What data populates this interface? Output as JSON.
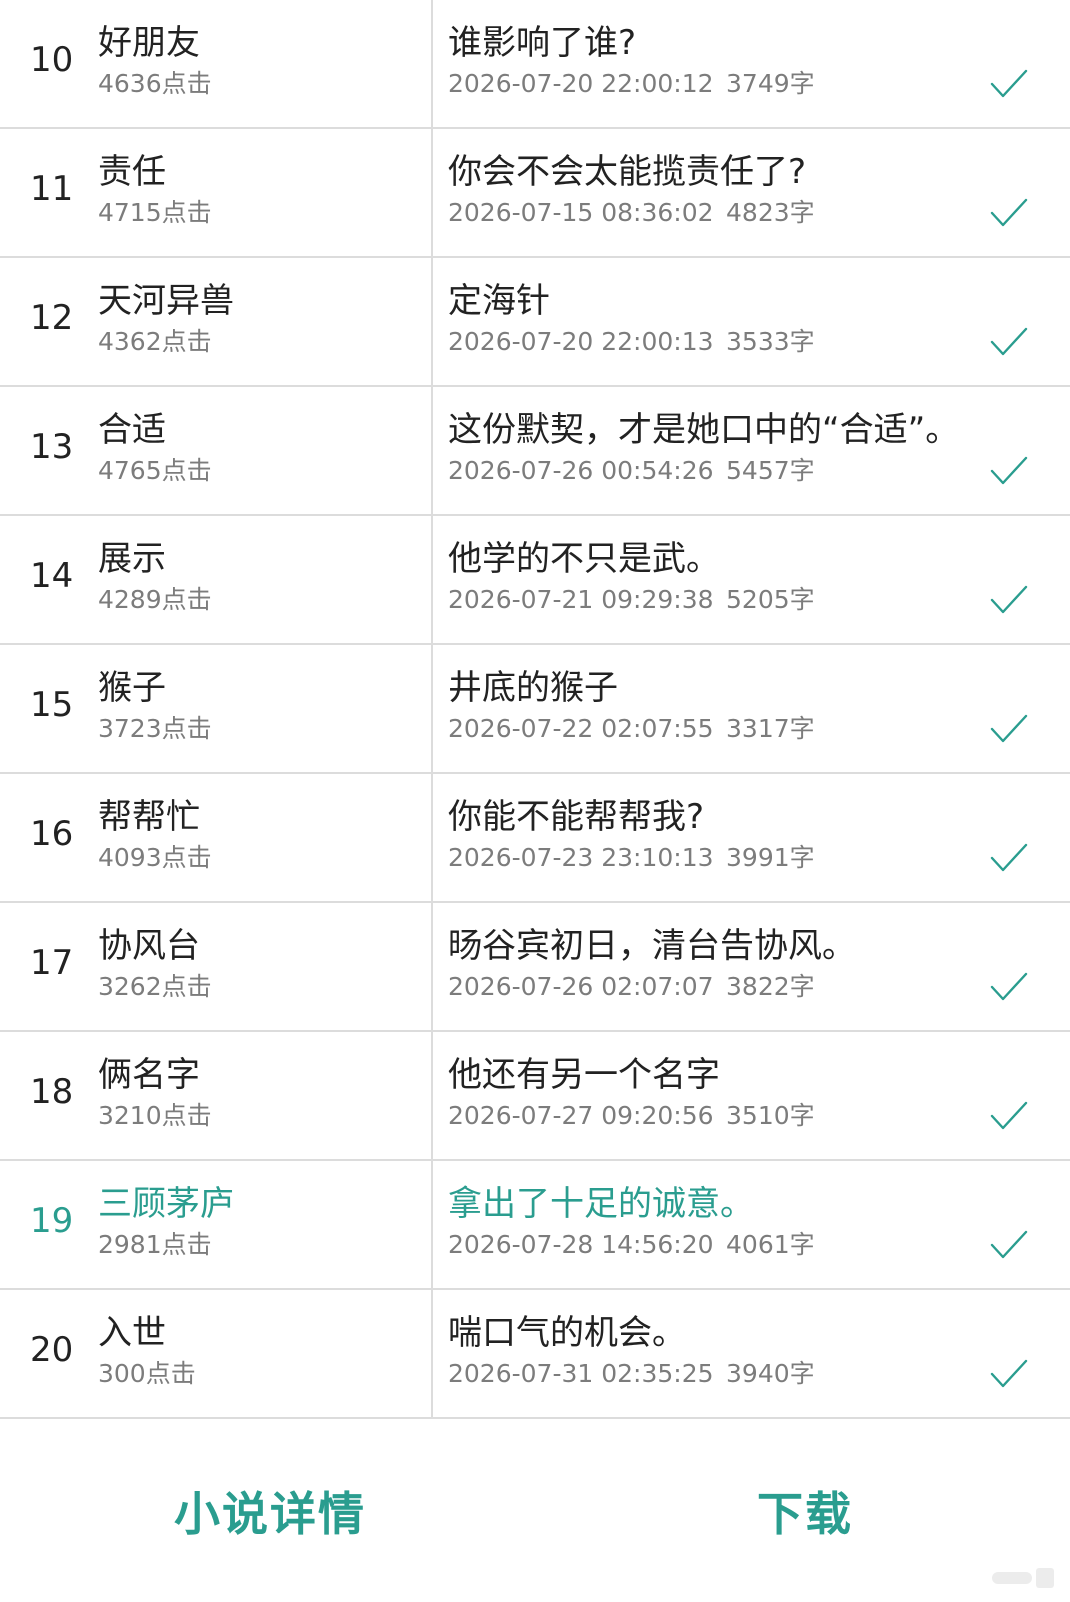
{
  "colors": {
    "accent": "#2a9d8f",
    "text": "#222222",
    "secondary_text": "#7c7c7c",
    "divider": "#dcdcdc"
  },
  "chapters": [
    {
      "number": "10",
      "title": "好朋友",
      "clicks": "4636点击",
      "chapter_title": "谁影响了谁?",
      "datetime": "2026-07-20 22:00:12",
      "words": "3749字",
      "status_icon": "check-icon",
      "current": false
    },
    {
      "number": "11",
      "title": "责任",
      "clicks": "4715点击",
      "chapter_title": "你会不会太能揽责任了?",
      "datetime": "2026-07-15 08:36:02",
      "words": "4823字",
      "status_icon": "check-icon",
      "current": false
    },
    {
      "number": "12",
      "title": "天河异兽",
      "clicks": "4362点击",
      "chapter_title": "定海针",
      "datetime": "2026-07-20 22:00:13",
      "words": "3533字",
      "status_icon": "check-icon",
      "current": false
    },
    {
      "number": "13",
      "title": "合适",
      "clicks": "4765点击",
      "chapter_title": "这份默契，才是她口中的“合适”。",
      "datetime": "2026-07-26 00:54:26",
      "words": "5457字",
      "status_icon": "check-icon",
      "current": false
    },
    {
      "number": "14",
      "title": "展示",
      "clicks": "4289点击",
      "chapter_title": "他学的不只是武。",
      "datetime": "2026-07-21 09:29:38",
      "words": "5205字",
      "status_icon": "check-icon",
      "current": false
    },
    {
      "number": "15",
      "title": "猴子",
      "clicks": "3723点击",
      "chapter_title": "井底的猴子",
      "datetime": "2026-07-22 02:07:55",
      "words": "3317字",
      "status_icon": "check-icon",
      "current": false
    },
    {
      "number": "16",
      "title": "帮帮忙",
      "clicks": "4093点击",
      "chapter_title": "你能不能帮帮我?",
      "datetime": "2026-07-23 23:10:13",
      "words": "3991字",
      "status_icon": "check-icon",
      "current": false
    },
    {
      "number": "17",
      "title": "协风台",
      "clicks": "3262点击",
      "chapter_title": "旸谷宾初日，清台告协风。",
      "datetime": "2026-07-26 02:07:07",
      "words": "3822字",
      "status_icon": "check-icon",
      "current": false
    },
    {
      "number": "18",
      "title": "俩名字",
      "clicks": "3210点击",
      "chapter_title": "他还有另一个名字",
      "datetime": "2026-07-27 09:20:56",
      "words": "3510字",
      "status_icon": "check-icon",
      "current": false
    },
    {
      "number": "19",
      "title": "三顾茅庐",
      "clicks": "2981点击",
      "chapter_title": "拿出了十足的诚意。",
      "datetime": "2026-07-28 14:56:20",
      "words": "4061字",
      "status_icon": "check-icon",
      "current": true
    },
    {
      "number": "20",
      "title": "入世",
      "clicks": "300点击",
      "chapter_title": "喘口气的机会。",
      "datetime": "2026-07-31 02:35:25",
      "words": "3940字",
      "status_icon": "check-icon",
      "current": false
    }
  ],
  "bottom_bar": {
    "details_label": "小说详情",
    "download_label": "下载"
  }
}
